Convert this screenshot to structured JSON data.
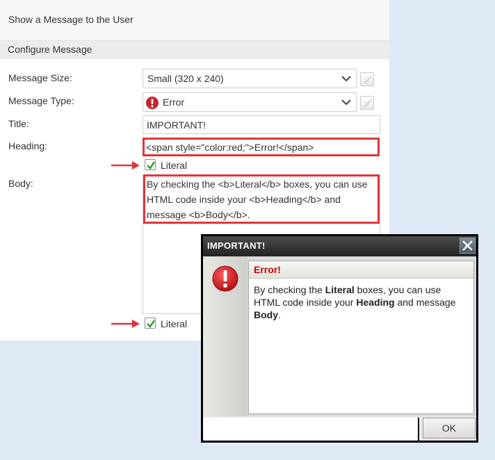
{
  "panel": {
    "title": "Show a Message to the User",
    "section_title": "Configure Message"
  },
  "form": {
    "message_size_label": "Message Size:",
    "message_size_value": "Small (320 x 240)",
    "message_type_label": "Message Type:",
    "message_type_value": "Error",
    "title_label": "Title:",
    "title_value": "IMPORTANT!",
    "heading_label": "Heading:",
    "heading_value": "<span style=\"color:red;\">Error!</span>",
    "heading_literal_label": "Literal",
    "heading_literal_checked": true,
    "body_label": "Body:",
    "body_value_line1": "By checking the <b>Literal</b> boxes, you can use",
    "body_value_line2": "HTML code inside your <b>Heading</b> and",
    "body_value_line3": "message <b>Body</b>.",
    "body_literal_label": "Literal",
    "body_literal_checked": true
  },
  "dialog": {
    "title": "IMPORTANT!",
    "heading": "Error!",
    "msg_part1": "By checking the ",
    "msg_bold1": "Literal",
    "msg_part2": " boxes, you can use HTML code inside your ",
    "msg_bold2": "Heading",
    "msg_part3": " and message ",
    "msg_bold3": "Body",
    "msg_part4": ".",
    "ok_label": "OK"
  },
  "colors": {
    "highlight": "#e0353b",
    "error_red": "#cc0000",
    "check_green": "#2e9e3a"
  },
  "icons": {
    "message_type": "error-icon",
    "dialog": "error-icon",
    "close": "close-icon",
    "dropdown": "chevron-down-icon"
  }
}
